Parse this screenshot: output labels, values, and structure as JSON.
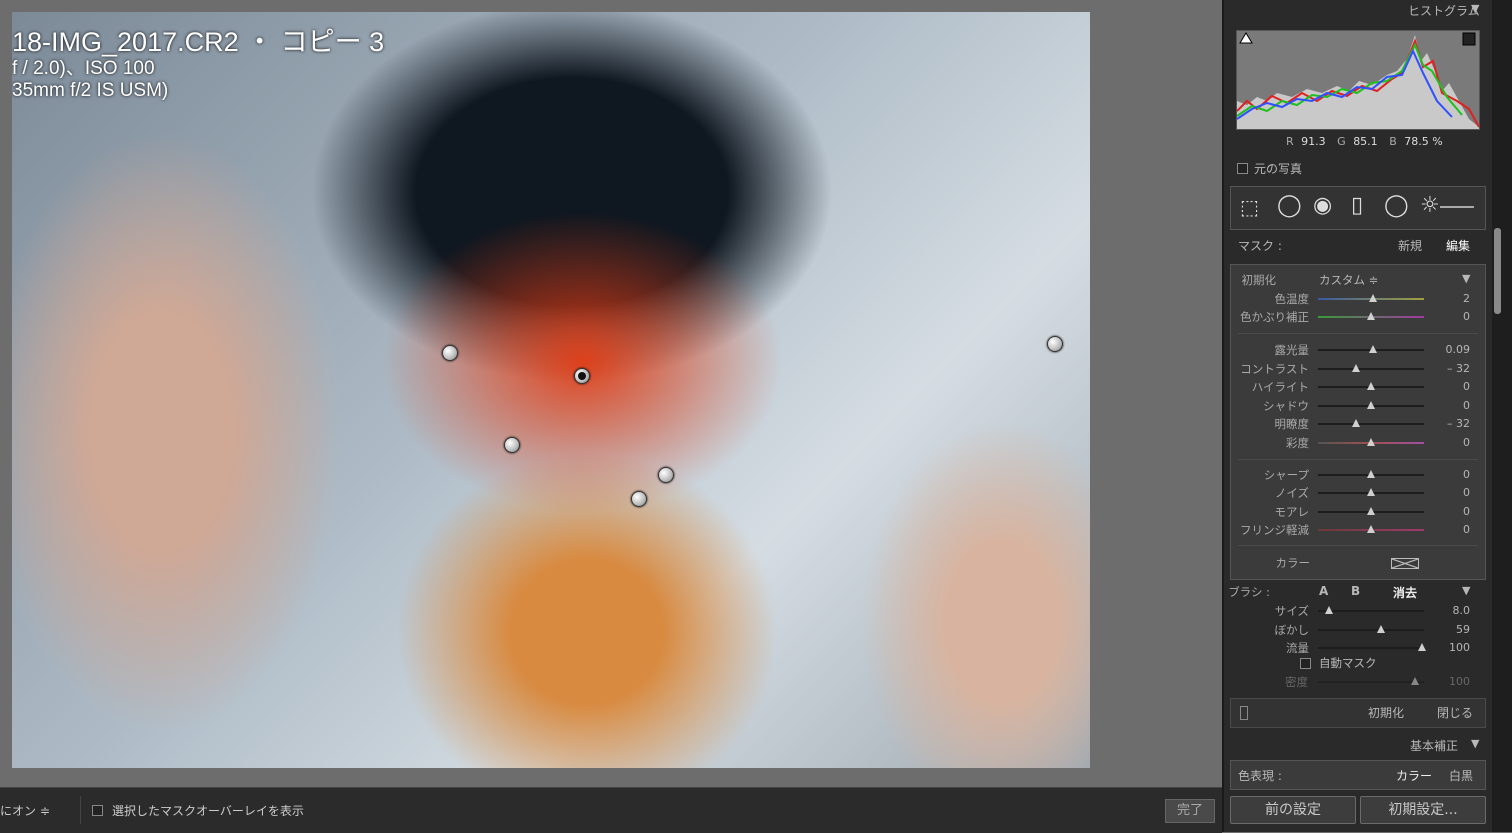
{
  "photo": {
    "exif_line1": "18-IMG_2017.CR2 ・ コピー 3",
    "exif_line2": "f / 2.0)、ISO 100",
    "exif_line3": "35mm f/2 IS USM)"
  },
  "toolbar": {
    "overlay_mode": "にオン ≑",
    "show_overlay_label": "選択したマスクオーバーレイを表示",
    "done_label": "完了"
  },
  "histogram": {
    "title": "ヒストグラム",
    "r_label": "R",
    "r_value": "91.3",
    "g_label": "G",
    "g_value": "85.1",
    "b_label": "B",
    "b_value": "78.5 %",
    "original_photo_label": "元の写真"
  },
  "mask": {
    "label": "マスク :",
    "new_label": "新規",
    "edit_label": "編集"
  },
  "effect": {
    "preset_label": "初期化",
    "preset_value": "カスタム ≑",
    "sliders_wb": [
      {
        "label": "色温度",
        "value": "2",
        "pos": 0.52
      },
      {
        "label": "色かぶり補正",
        "value": "0",
        "pos": 0.5
      }
    ],
    "sliders_tone": [
      {
        "label": "露光量",
        "value": "0.09",
        "pos": 0.52
      },
      {
        "label": "コントラスト",
        "value": "– 32",
        "pos": 0.36
      },
      {
        "label": "ハイライト",
        "value": "0",
        "pos": 0.5
      },
      {
        "label": "シャドウ",
        "value": "0",
        "pos": 0.5
      },
      {
        "label": "明瞭度",
        "value": "– 32",
        "pos": 0.36
      },
      {
        "label": "彩度",
        "value": "0",
        "pos": 0.5
      }
    ],
    "sliders_detail": [
      {
        "label": "シャープ",
        "value": "0",
        "pos": 0.5
      },
      {
        "label": "ノイズ",
        "value": "0",
        "pos": 0.5
      },
      {
        "label": "モアレ",
        "value": "0",
        "pos": 0.5
      },
      {
        "label": "フリンジ軽減",
        "value": "0",
        "pos": 0.5
      }
    ],
    "color_label": "カラー"
  },
  "brush": {
    "label": "ブラシ :",
    "a": "A",
    "b": "B",
    "erase": "消去",
    "sliders": [
      {
        "label": "サイズ",
        "value": "8.0",
        "pos": 0.1
      },
      {
        "label": "ぼかし",
        "value": "59",
        "pos": 0.59
      },
      {
        "label": "流量",
        "value": "100",
        "pos": 0.98
      }
    ],
    "auto_mask_label": "自動マスク",
    "density_label": "密度",
    "density_value": "100",
    "density_pos": 0.98
  },
  "footer": {
    "reset_label": "初期化",
    "close_label": "閉じる",
    "basic_label": "基本補正",
    "treatment_label": "色表現 :",
    "color_option": "カラー",
    "bw_option": "白黒",
    "prev_button": "前の設定",
    "reset_button": "初期設定..."
  },
  "colors": {
    "panel_bg": "#2a2a2a",
    "section_bg": "#3b3b3b",
    "mask_overlay": "#e03a14"
  }
}
